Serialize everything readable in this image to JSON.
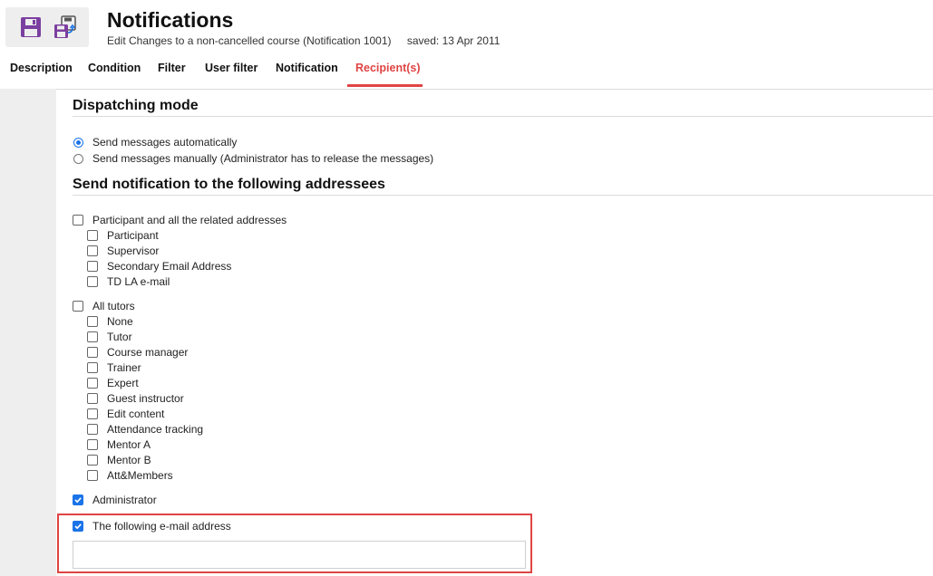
{
  "header": {
    "title": "Notifications",
    "subtitle": "Edit Changes to a non-cancelled course (Notification 1001)",
    "saved": "saved: 13 Apr 2011"
  },
  "toolbar": {
    "save_icon": "floppy-disk-icon",
    "save_as_icon": "save-as-icon"
  },
  "tabs": [
    {
      "label": "Description"
    },
    {
      "label": "Condition"
    },
    {
      "label": "Filter"
    },
    {
      "label": "User filter"
    },
    {
      "label": "Notification"
    },
    {
      "label": "Recipient(s)",
      "active": true
    }
  ],
  "dispatching": {
    "title": "Dispatching mode",
    "options": [
      {
        "label": "Send messages automatically",
        "selected": true
      },
      {
        "label": "Send messages manually (Administrator has to release the messages)",
        "selected": false
      }
    ]
  },
  "addressees": {
    "title": "Send notification to the following addressees",
    "participant_group": {
      "label": "Participant and all the related addresses",
      "items": [
        "Participant",
        "Supervisor",
        "Secondary Email Address",
        "TD LA e-mail"
      ]
    },
    "tutors_group": {
      "label": "All tutors",
      "items": [
        "None",
        "Tutor",
        "Course manager",
        "Trainer",
        "Expert",
        "Guest instructor",
        "Edit content",
        "Attendance tracking",
        "Mentor A",
        "Mentor B",
        "Att&Members"
      ]
    },
    "administrator": {
      "label": "Administrator",
      "checked": true
    },
    "email": {
      "label": "The following e-mail address",
      "checked": true,
      "value": ""
    }
  },
  "colors": {
    "accent": "#e04444",
    "check": "#1a73e8",
    "toolbar_icon": "#7b3fa0"
  }
}
